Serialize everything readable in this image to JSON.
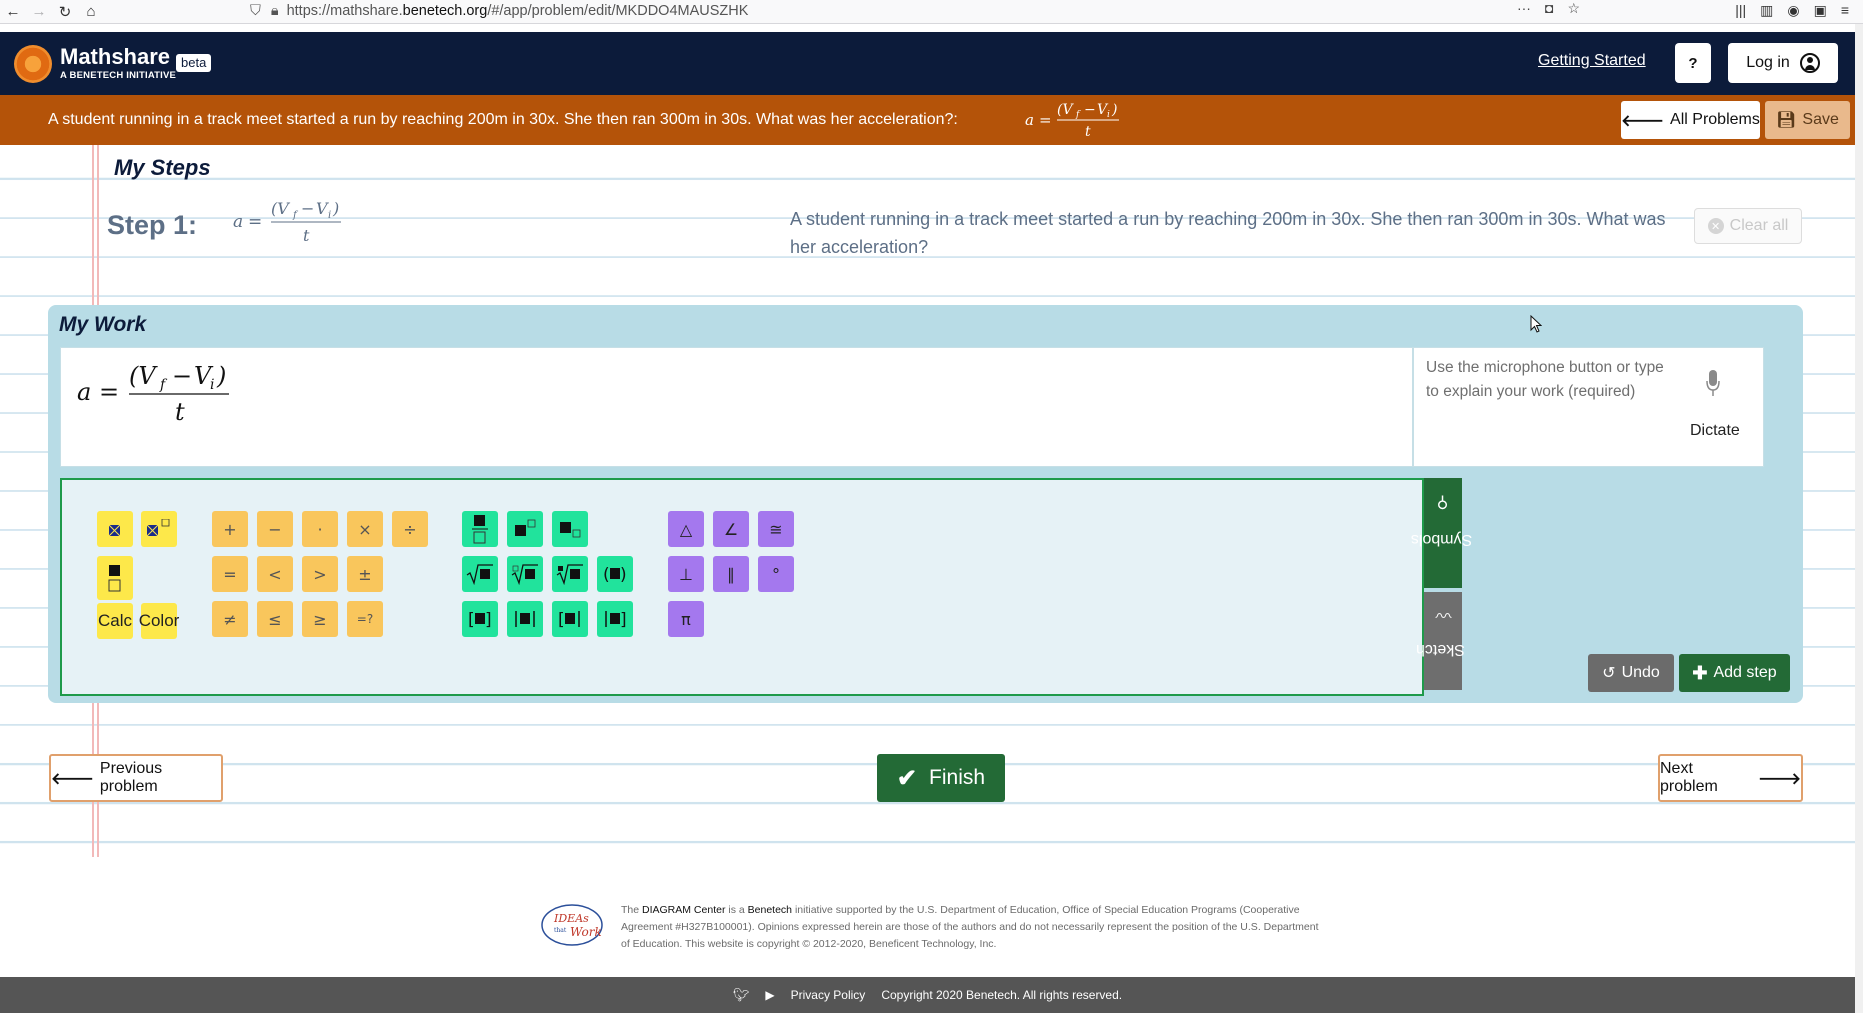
{
  "browser": {
    "url_prefix": "https://mathshare.",
    "url_host": "benetech.org",
    "url_suffix": "/#/app/problem/edit/MKDDO4MAUSZHK",
    "more_icon": "···"
  },
  "header": {
    "brand": "Mathshare",
    "tagline": "A BENETECH INITIATIVE",
    "badge": "beta",
    "getting_started": "Getting Started",
    "help": "?",
    "login": "Log in"
  },
  "problem_bar": {
    "text": "A student running in a track meet started a run by reaching 200m in 30x. She then ran 300m in 30s. What was her acceleration?:",
    "all_problems": "All Problems",
    "save": "Save"
  },
  "steps": {
    "title": "My Steps",
    "step_label": "Step 1:",
    "description": "A student running in a track meet started a run by reaching 200m in 30x. She then ran 300m in 30s. What was her acceleration?",
    "clear_all": "Clear all"
  },
  "work": {
    "title": "My Work",
    "placeholder": "Use the microphone button or type to explain your work (required)",
    "dictate": "Dictate",
    "undo": "Undo",
    "add_step": "Add step"
  },
  "palette": {
    "calc": "Calc",
    "color": "Color",
    "ops_row1": [
      "+",
      "−",
      "·",
      "×",
      "÷"
    ],
    "ops_row2": [
      "=",
      "<",
      ">",
      "±"
    ],
    "ops_row3": [
      "≠",
      "≤",
      "≥",
      "=?"
    ],
    "geo_row1": [
      "△",
      "∠",
      "≅"
    ],
    "geo_row2": [
      "⊥",
      "∥",
      "°"
    ],
    "geo_row3": [
      "π"
    ],
    "tab_symbols": "Symbols",
    "tab_sketch": "Sketch"
  },
  "nav": {
    "previous": "Previous problem",
    "finish": "Finish",
    "next": "Next problem"
  },
  "footer": {
    "logo_text": "IDEAs that Work",
    "the": "The",
    "diagram": "DIAGRAM Center",
    "is_a": "is a",
    "benetech": "Benetech",
    "rest": "initiative supported by the U.S. Department of Education, Office of Special Education Programs (Cooperative Agreement #H327B100001). Opinions expressed herein are those of the authors and do not necessarily represent the position of the U.S. Department of Education. This website is copyright © 2012-2020, Beneficent Technology, Inc.",
    "privacy": "Privacy Policy",
    "copyright": "Copyright 2020 Benetech. All rights reserved."
  },
  "colors": {
    "header": "#0c1b3a",
    "problem_bar": "#b45309",
    "panel": "#b8dce6",
    "green": "#236a36",
    "key_yellow": "#fde84a",
    "key_orange": "#f9c65c",
    "key_green": "#21e39c",
    "key_purple": "#a478ee"
  }
}
